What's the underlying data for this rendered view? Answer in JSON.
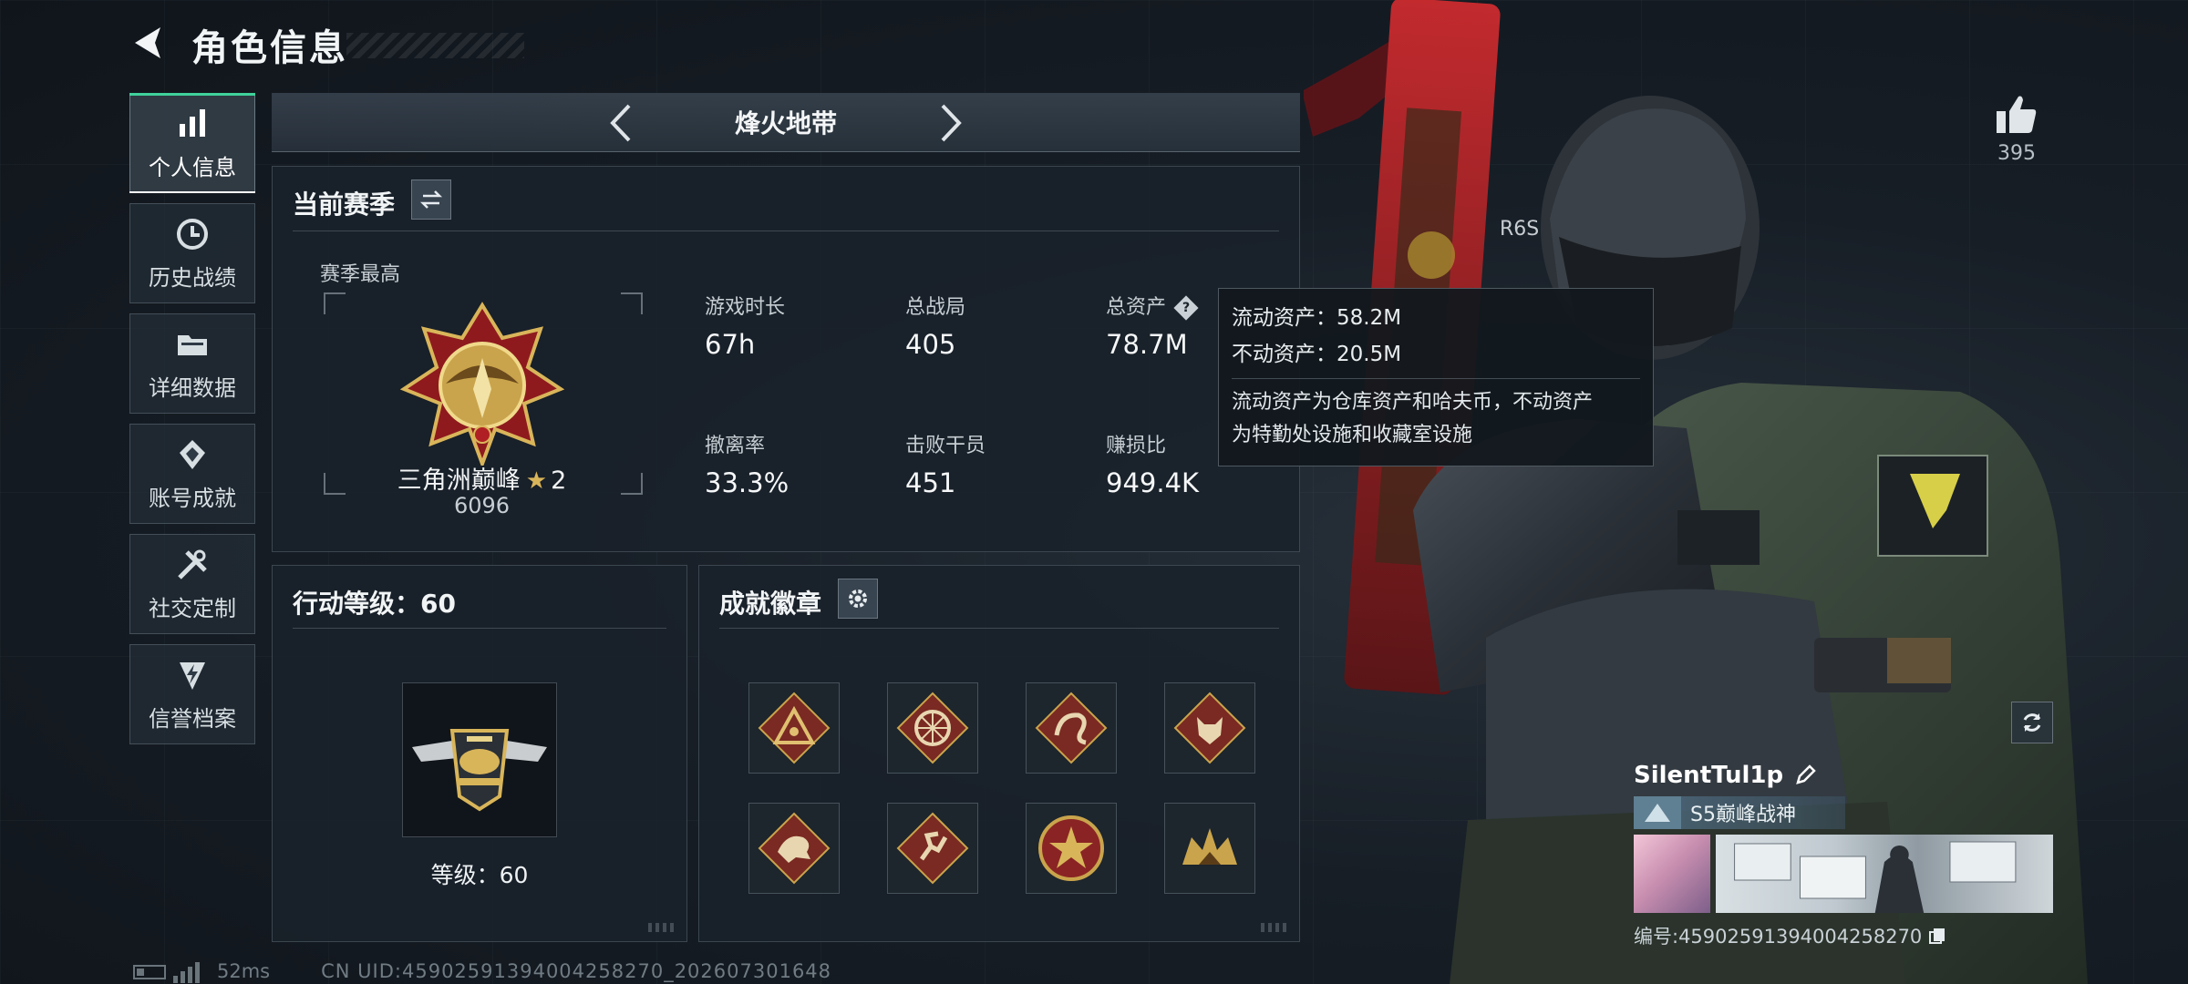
{
  "header": {
    "title": "角色信息"
  },
  "side_nav": [
    {
      "label": "个人信息",
      "icon": "bar-chart-icon",
      "active": true
    },
    {
      "label": "历史战绩",
      "icon": "clock-icon",
      "active": false
    },
    {
      "label": "详细数据",
      "icon": "folder-icon",
      "active": false
    },
    {
      "label": "账号成就",
      "icon": "medal-icon",
      "active": false
    },
    {
      "label": "社交定制",
      "icon": "wrench-icon",
      "active": false
    },
    {
      "label": "信誉档案",
      "icon": "shield-lightning-icon",
      "active": false
    }
  ],
  "mode": {
    "title": "烽火地带"
  },
  "season": {
    "header": "当前赛季",
    "best_label": "赛季最高",
    "rank_name": "三角洲巅峰",
    "rank_stars": "2",
    "rank_score": "6096",
    "stats": [
      {
        "label": "游戏时长",
        "value": "67h"
      },
      {
        "label": "总战局",
        "value": "405"
      },
      {
        "label": "总资产",
        "value": "78.7M"
      },
      {
        "label": "撤离率",
        "value": "33.3%"
      },
      {
        "label": "击败干员",
        "value": "451"
      },
      {
        "label": "赚损比",
        "value": "949.4K"
      }
    ],
    "help_symbol": "?"
  },
  "tooltip": {
    "liquid": "流动资产：58.2M",
    "fixed": "不动资产：20.5M",
    "desc_line1": "流动资产为仓库资产和哈夫币，不动资产",
    "desc_line2": "为特勤处设施和收藏室设施"
  },
  "action_level": {
    "header": "行动等级：60",
    "caption": "等级：60"
  },
  "badges": {
    "header": "成就徽章",
    "items": [
      "triangle-eye-badge",
      "wheel-badge",
      "serpent-badge",
      "wolf-badge",
      "dragon-badge",
      "runner-badge",
      "star-seal-badge",
      "beast-badge"
    ]
  },
  "profile": {
    "likes": "395",
    "username": "SilentTul1p",
    "title": "S5巅峰战神",
    "id_text": "编号:4590259139400425827​0"
  },
  "status": {
    "ping": "52ms",
    "uid": "CN UID:4590259139400425827​0_202607301648"
  },
  "colors": {
    "accent": "#3fd29b",
    "gold": "#d9b55a"
  }
}
